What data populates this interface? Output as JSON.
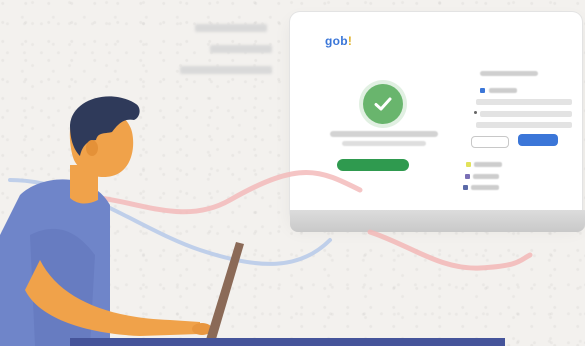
{
  "logo": {
    "text_main": "gob",
    "text_accent": "!"
  },
  "icons": {
    "success": "check-circle-icon"
  },
  "colors": {
    "background": "#f3f1ee",
    "success_green": "#69b56d",
    "button_green": "#2f9a4f",
    "primary_blue": "#3b76d8",
    "skin": "#f0a24a",
    "hair": "#2f3a5a",
    "shirt": "#6f85c9",
    "laptop": "#8b6a57",
    "ribbon_pink": "#f2b7b6",
    "ribbon_blue": "#b9cbe9"
  }
}
